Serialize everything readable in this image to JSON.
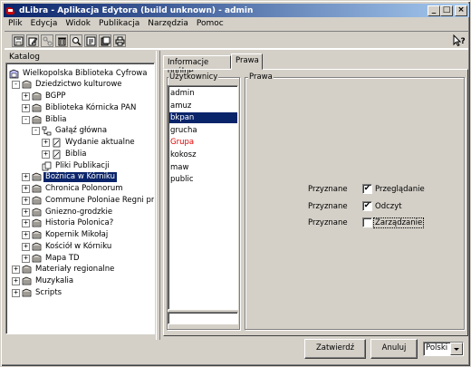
{
  "window": {
    "title": "dLibra - Aplikacja Edytora (build unknown) - admin",
    "minimize_glyph": "_",
    "maximize_glyph": "□",
    "close_glyph": "×"
  },
  "menu": [
    "Plik",
    "Edycja",
    "Widok",
    "Publikacja",
    "Narzędzia",
    "Pomoc"
  ],
  "toolbar": {
    "tools": [
      "save-icon",
      "edit-icon",
      "link-icon",
      "trash-icon",
      "search-icon",
      "properties-icon",
      "export-icon",
      "print-icon"
    ],
    "help_icon": "help-cursor-icon"
  },
  "catalog": {
    "label": "Katalog",
    "root": "Wielkopolska Biblioteka Cyfrowa",
    "items": [
      "Dziedzictwo kulturowe",
      "BGPP",
      "Biblioteka Kórnicka PAN",
      "Biblia",
      "Gałąź główna",
      "Wydanie aktualne",
      "Biblia",
      "Pliki Publikacji",
      "Bożnica w Kórniku",
      "Chronica Polonorum",
      "Commune Poloniae Regni pr",
      "Gniezno-grodzkie",
      "Historia Polonica?",
      "Kopernik Mikołaj",
      "Kościół w Kórniku",
      "Mapa TD",
      "Materiały regionalne",
      "Muzykalia",
      "Scripts"
    ]
  },
  "tabs": [
    "Informacje ogólne",
    "Prawa"
  ],
  "active_tab": "Prawa",
  "users": {
    "label": "Użytkownicy",
    "list": [
      "admin",
      "amuz",
      "bkpan",
      "grucha",
      "Grupa",
      "kokosz",
      "maw",
      "public"
    ],
    "selected": "bkpan",
    "search_value": ""
  },
  "rights": {
    "label": "Prawa",
    "permissions": [
      {
        "status": "Przyznane",
        "checked": true,
        "name": "Przeglądanie"
      },
      {
        "status": "Przyznane",
        "checked": true,
        "name": "Odczyt"
      },
      {
        "status": "Przyznane",
        "checked": false,
        "name": "Zarządzanie"
      }
    ],
    "check_glyph": "✔"
  },
  "buttons": {
    "confirm": "Zatwierdź",
    "cancel": "Anuluj",
    "language": "Polski"
  },
  "colors": {
    "selection": "#0a246a",
    "group_text": "#e00000",
    "title_gradient_start": "#0a246a",
    "title_gradient_end": "#a6caf0"
  }
}
